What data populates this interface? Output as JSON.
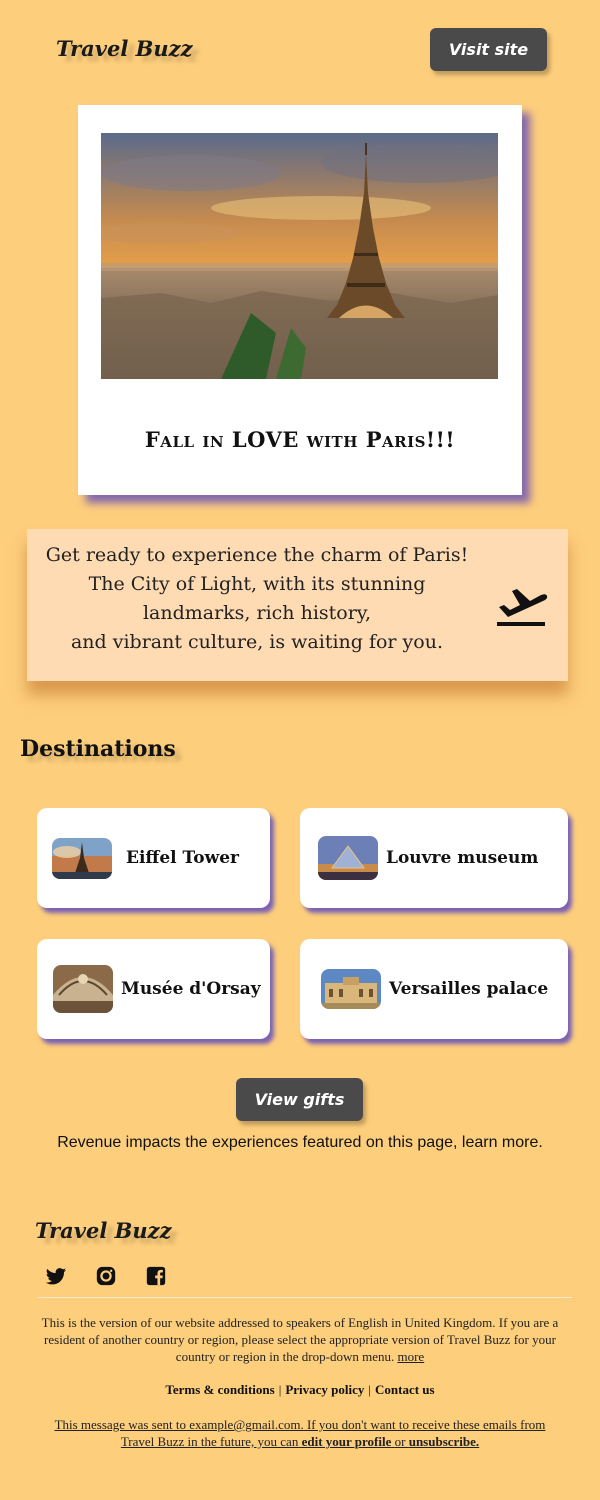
{
  "header": {
    "brand": "Travel Buzz",
    "visit_label": "Visit site"
  },
  "hero": {
    "title": "Fall in LOVE with Paris!!!"
  },
  "intro": {
    "line1": "Get ready to experience the charm of Paris!",
    "line2": "The City of Light, with its stunning",
    "line3": "landmarks, rich history,",
    "line4": "and vibrant culture, is waiting for you.",
    "icon": "airplane-takeoff-icon"
  },
  "destinations": {
    "title": "Destinations",
    "items": [
      {
        "label": "Eiffel Tower"
      },
      {
        "label": "Louvre museum"
      },
      {
        "label": "Musée d'Orsay"
      },
      {
        "label": "Versailles palace"
      }
    ]
  },
  "gifts": {
    "label": "View gifts",
    "disclaimer": "Revenue impacts the experiences featured on this page, learn more."
  },
  "footer": {
    "brand": "Travel Buzz",
    "social": [
      "twitter-icon",
      "instagram-icon",
      "facebook-icon"
    ],
    "notice": "This is the version of our website addressed to speakers of English in United Kingdom. If you are a resident of another country or region, please select the appropriate version of Travel Buzz for your country or region in the drop-down menu.",
    "more": "more",
    "links": [
      "Terms & conditions",
      "Privacy policy",
      "Contact us"
    ],
    "sent_prefix": "This message was sent to example@gmail.com. If you don't want to receive these emails from Travel Buzz in the future, you can",
    "edit_profile": "edit your profile",
    "or": "or",
    "unsubscribe": "unsubscribe."
  },
  "colors": {
    "background": "#fdce7c",
    "button": "#4a4a4a",
    "card_shadow": "#6a56c8",
    "intro_panel": "#fedbb2"
  }
}
